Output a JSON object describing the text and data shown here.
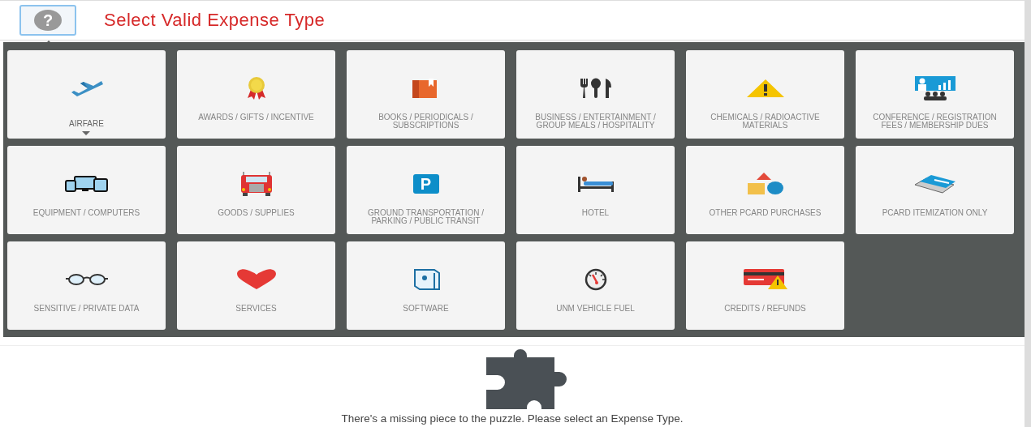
{
  "header": {
    "help_icon_label": "?",
    "title": "Select Valid Expense Type"
  },
  "expense_types": [
    {
      "label": "AIRFARE",
      "selected": true
    },
    {
      "label": "AWARDS / GIFTS / INCENTIVE",
      "selected": false
    },
    {
      "label": "BOOKS / PERIODICALS / SUBSCRIPTIONS",
      "selected": false
    },
    {
      "label": "BUSINESS / ENTERTAINMENT / GROUP MEALS / HOSPITALITY",
      "selected": false
    },
    {
      "label": "CHEMICALS / RADIOACTIVE MATERIALS",
      "selected": false
    },
    {
      "label": "CONFERENCE / REGISTRATION FEES / MEMBERSHIP DUES",
      "selected": false
    },
    {
      "label": "EQUIPMENT / COMPUTERS",
      "selected": false
    },
    {
      "label": "GOODS / SUPPLIES",
      "selected": false
    },
    {
      "label": "GROUND TRANSPORTATION / PARKING / PUBLIC TRANSIT",
      "selected": false
    },
    {
      "label": "HOTEL",
      "selected": false
    },
    {
      "label": "OTHER PCARD PURCHASES",
      "selected": false
    },
    {
      "label": "PCARD ITEMIZATION ONLY",
      "selected": false
    },
    {
      "label": "SENSITIVE / PRIVATE DATA",
      "selected": false
    },
    {
      "label": "SERVICES",
      "selected": false
    },
    {
      "label": "SOFTWARE",
      "selected": false
    },
    {
      "label": "UNM VEHICLE FUEL",
      "selected": false
    },
    {
      "label": "CREDITS / REFUNDS",
      "selected": false
    }
  ],
  "parking_icon_label": "P",
  "empty_message": "There's a missing piece to the puzzle. Please select an Expense Type."
}
